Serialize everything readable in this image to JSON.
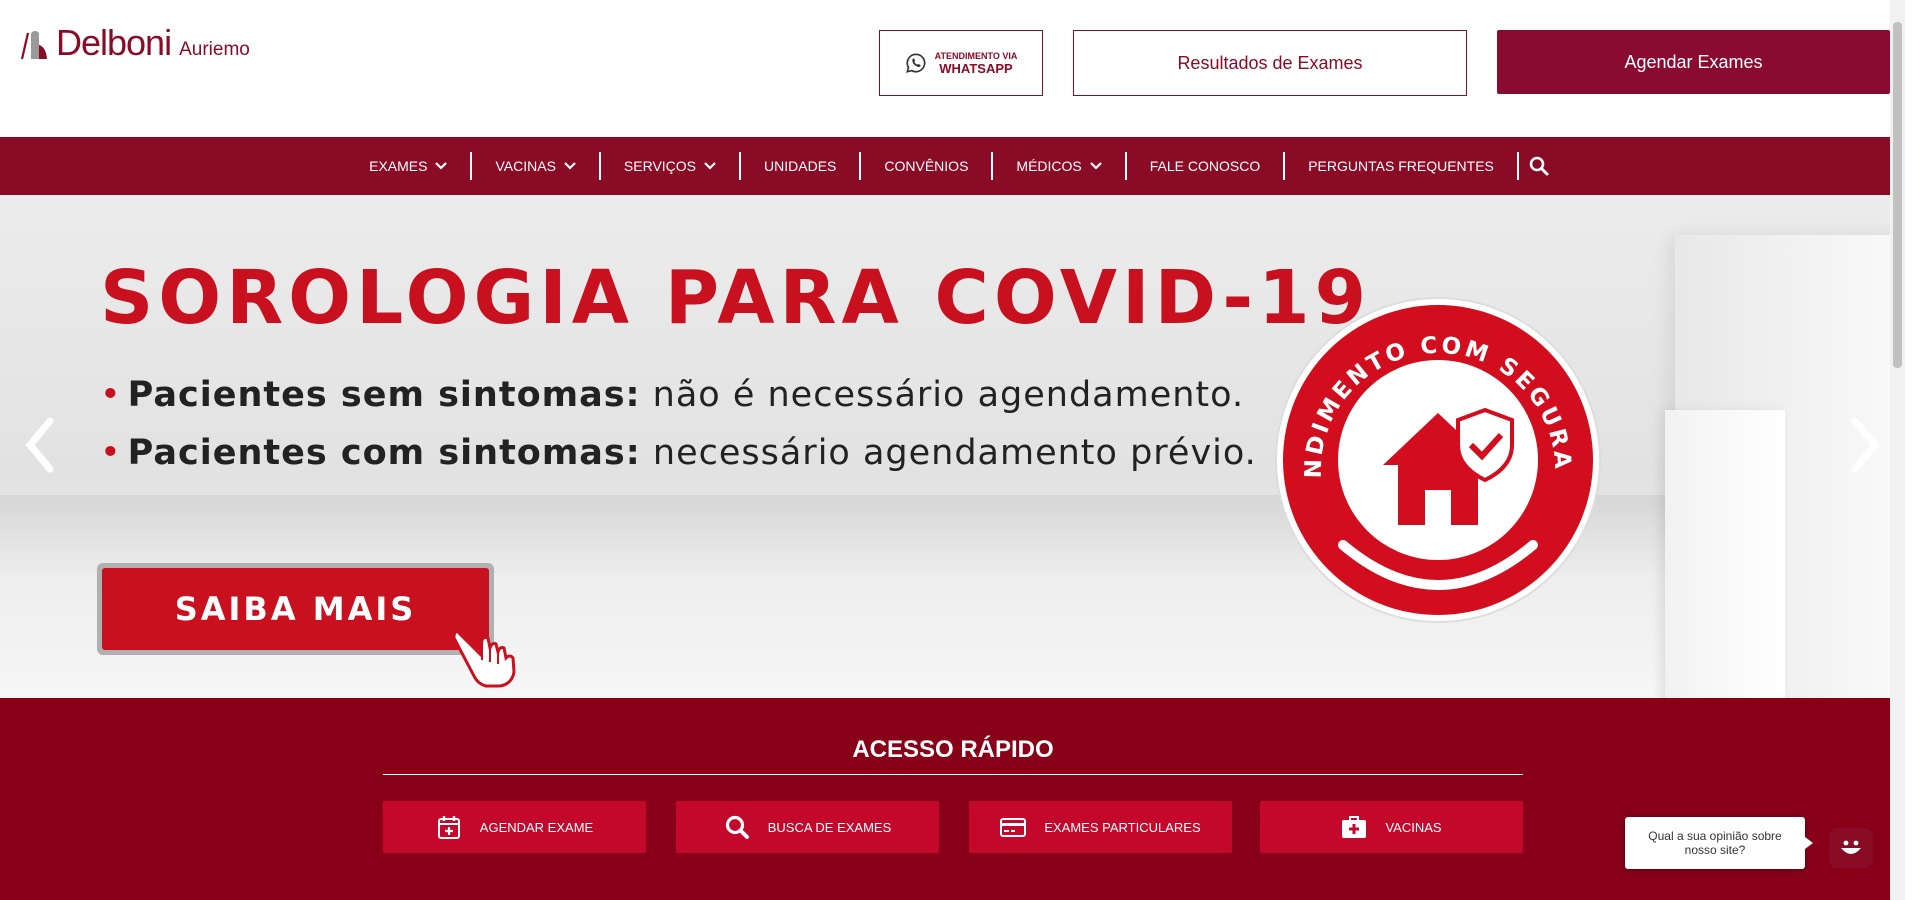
{
  "brand": {
    "name": "Delboni",
    "sub": "Auriemo",
    "color": "#8a0b26"
  },
  "header": {
    "whatsapp_small": "ATENDIMENTO VIA",
    "whatsapp_big": "WHATSAPP",
    "results_label": "Resultados de Exames",
    "schedule_label": "Agendar Exames"
  },
  "nav": {
    "items": [
      {
        "label": "EXAMES",
        "dropdown": true
      },
      {
        "label": "VACINAS",
        "dropdown": true
      },
      {
        "label": "SERVIÇOS",
        "dropdown": true
      },
      {
        "label": "UNIDADES",
        "dropdown": false
      },
      {
        "label": "CONVÊNIOS",
        "dropdown": false
      },
      {
        "label": "MÉDICOS",
        "dropdown": true
      },
      {
        "label": "FALE CONOSCO",
        "dropdown": false
      },
      {
        "label": "PERGUNTAS FREQUENTES",
        "dropdown": false
      }
    ],
    "search_icon": "search-icon"
  },
  "hero": {
    "title": "SOROLOGIA PARA COVID-19",
    "bullet1_bold": "Pacientes sem sintomas:",
    "bullet1_rest": " não é necessário agendamento.",
    "bullet2_bold": "Pacientes com sintomas:",
    "bullet2_rest": " necessário agendamento prévio.",
    "cta": "SAIBA MAIS",
    "seal_text": "ATENDIMENTO COM SEGURANÇA",
    "accent": "#c8101f"
  },
  "quick": {
    "title": "ACESSO RÁPIDO",
    "buttons": [
      {
        "label": "AGENDAR EXAME",
        "icon": "calendar-plus-icon"
      },
      {
        "label": "BUSCA DE EXAMES",
        "icon": "search-icon"
      },
      {
        "label": "EXAMES PARTICULARES",
        "icon": "credit-card-icon"
      },
      {
        "label": "VACINAS",
        "icon": "medkit-icon"
      }
    ]
  },
  "feedback": {
    "text": "Qual a sua opinião sobre nosso site?"
  }
}
